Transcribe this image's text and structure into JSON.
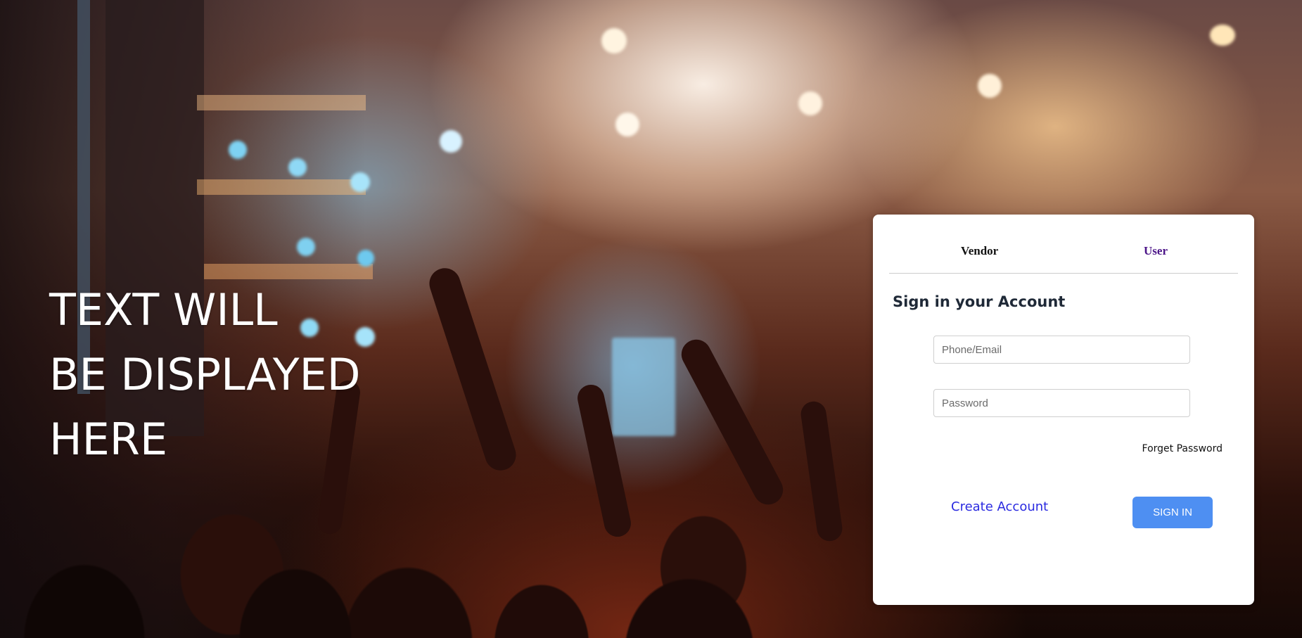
{
  "hero": {
    "lines": [
      "TEXT WILL",
      "BE DISPLAYED",
      "HERE"
    ]
  },
  "login": {
    "tabs": [
      {
        "label": "Vendor",
        "color": "#111111"
      },
      {
        "label": "User",
        "color": "#4b1488"
      }
    ],
    "title": "Sign in your Account",
    "phone_placeholder": "Phone/Email",
    "password_placeholder": "Password",
    "forget_password": "Forget Password",
    "create_account": "Create Account",
    "sign_in": "SIGN IN",
    "sign_in_color": "#4e8ff2",
    "create_account_color": "#2a2ae0"
  },
  "background": {
    "description_icon": "concert-crowd-image"
  }
}
